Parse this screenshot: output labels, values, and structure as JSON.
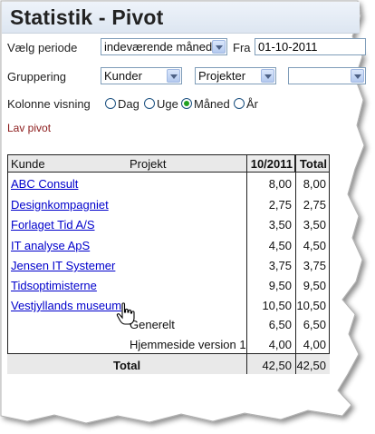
{
  "title": "Statistik - Pivot",
  "filters": {
    "period_label": "Vælg periode",
    "period_value": "indeværende måned",
    "from_label": "Fra",
    "from_value": "01-10-2011",
    "grouping_label": "Gruppering",
    "group1": "Kunder",
    "group2": "Projekter",
    "group3": "",
    "column_label": "Kolonne visning",
    "radio_options": [
      "Dag",
      "Uge",
      "Måned",
      "År"
    ],
    "radio_selected": "Måned",
    "make_pivot": "Lav pivot"
  },
  "table": {
    "headers": {
      "customer": "Kunde",
      "project": "Projekt",
      "period": "10/2011",
      "total": "Total"
    },
    "rows": [
      {
        "customer": "ABC Consult",
        "project": "",
        "period": "8,00",
        "total": "8,00"
      },
      {
        "customer": "Designkompagniet",
        "project": "",
        "period": "2,75",
        "total": "2,75"
      },
      {
        "customer": "Forlaget Tid A/S",
        "project": "",
        "period": "3,50",
        "total": "3,50"
      },
      {
        "customer": "IT analyse ApS",
        "project": "",
        "period": "4,50",
        "total": "4,50"
      },
      {
        "customer": "Jensen IT Systemer",
        "project": "",
        "period": "3,75",
        "total": "3,75"
      },
      {
        "customer": "Tidsoptimisterne",
        "project": "",
        "period": "9,50",
        "total": "9,50"
      },
      {
        "customer": "Vestjyllands museum",
        "project": "",
        "period": "10,50",
        "total": "10,50"
      },
      {
        "customer": "",
        "project": "Generelt",
        "period": "6,50",
        "total": "6,50"
      },
      {
        "customer": "",
        "project": "Hjemmeside version 1",
        "period": "4,00",
        "total": "4,00"
      }
    ],
    "footer": {
      "label": "Total",
      "period": "42,50",
      "total": "42,50"
    }
  },
  "colors": {
    "link": "#0000cc",
    "accent_link": "#8b1a1a",
    "header_bg": "#e9e9e9"
  },
  "icons": [
    "dropdown-arrow-icon",
    "hand-cursor-icon"
  ]
}
